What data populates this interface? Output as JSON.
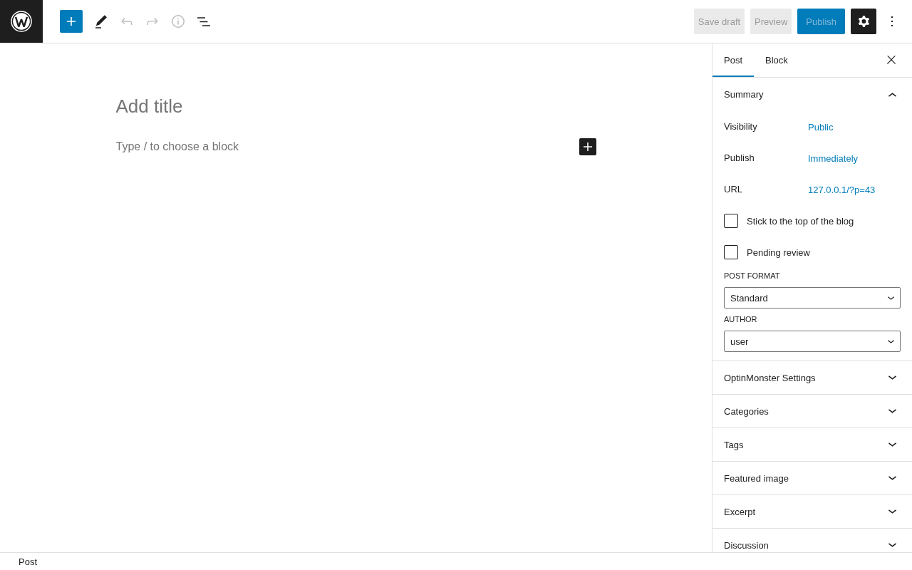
{
  "toolbar": [
    {
      "kind": "inserter",
      "disabled": false
    },
    {
      "kind": "tools",
      "disabled": false
    },
    {
      "kind": "undo",
      "disabled": true
    },
    {
      "kind": "redo",
      "disabled": true
    },
    {
      "kind": "details",
      "disabled": true
    },
    {
      "kind": "list_view",
      "disabled": false
    }
  ],
  "actions": [
    {
      "kind": "save_draft",
      "label": "Save draft",
      "disabled": true
    },
    {
      "kind": "preview",
      "label": "Preview",
      "disabled": true
    },
    {
      "kind": "publish",
      "label": "Publish",
      "disabled": true
    },
    {
      "kind": "settings",
      "pressed": true
    },
    {
      "kind": "more"
    }
  ],
  "editor": {
    "title_placeholder": "Add title",
    "block_placeholder": "Type / to choose a block"
  },
  "sidebar": {
    "tabs": [
      {
        "label": "Post",
        "selected": true
      },
      {
        "label": "Block",
        "selected": false
      }
    ],
    "panels": [
      {
        "title": "Summary",
        "expanded": true,
        "rows": [
          {
            "label": "Visibility",
            "value": "Public"
          },
          {
            "label": "Publish",
            "value": "Immediately"
          },
          {
            "label": "URL",
            "value": "127.0.0.1/?p=43"
          }
        ],
        "checkboxes": [
          {
            "label": "Stick to the top of the blog",
            "checked": false
          },
          {
            "label": "Pending review",
            "checked": false
          }
        ],
        "fields": [
          {
            "label": "POST FORMAT",
            "value": "Standard"
          },
          {
            "label": "AUTHOR",
            "value": "user"
          }
        ]
      },
      {
        "title": "OptinMonster Settings",
        "expanded": false
      },
      {
        "title": "Categories",
        "expanded": false
      },
      {
        "title": "Tags",
        "expanded": false
      },
      {
        "title": "Featured image",
        "expanded": false
      },
      {
        "title": "Excerpt",
        "expanded": false
      },
      {
        "title": "Discussion",
        "expanded": false
      }
    ]
  },
  "footer": {
    "breadcrumb": "Post"
  }
}
